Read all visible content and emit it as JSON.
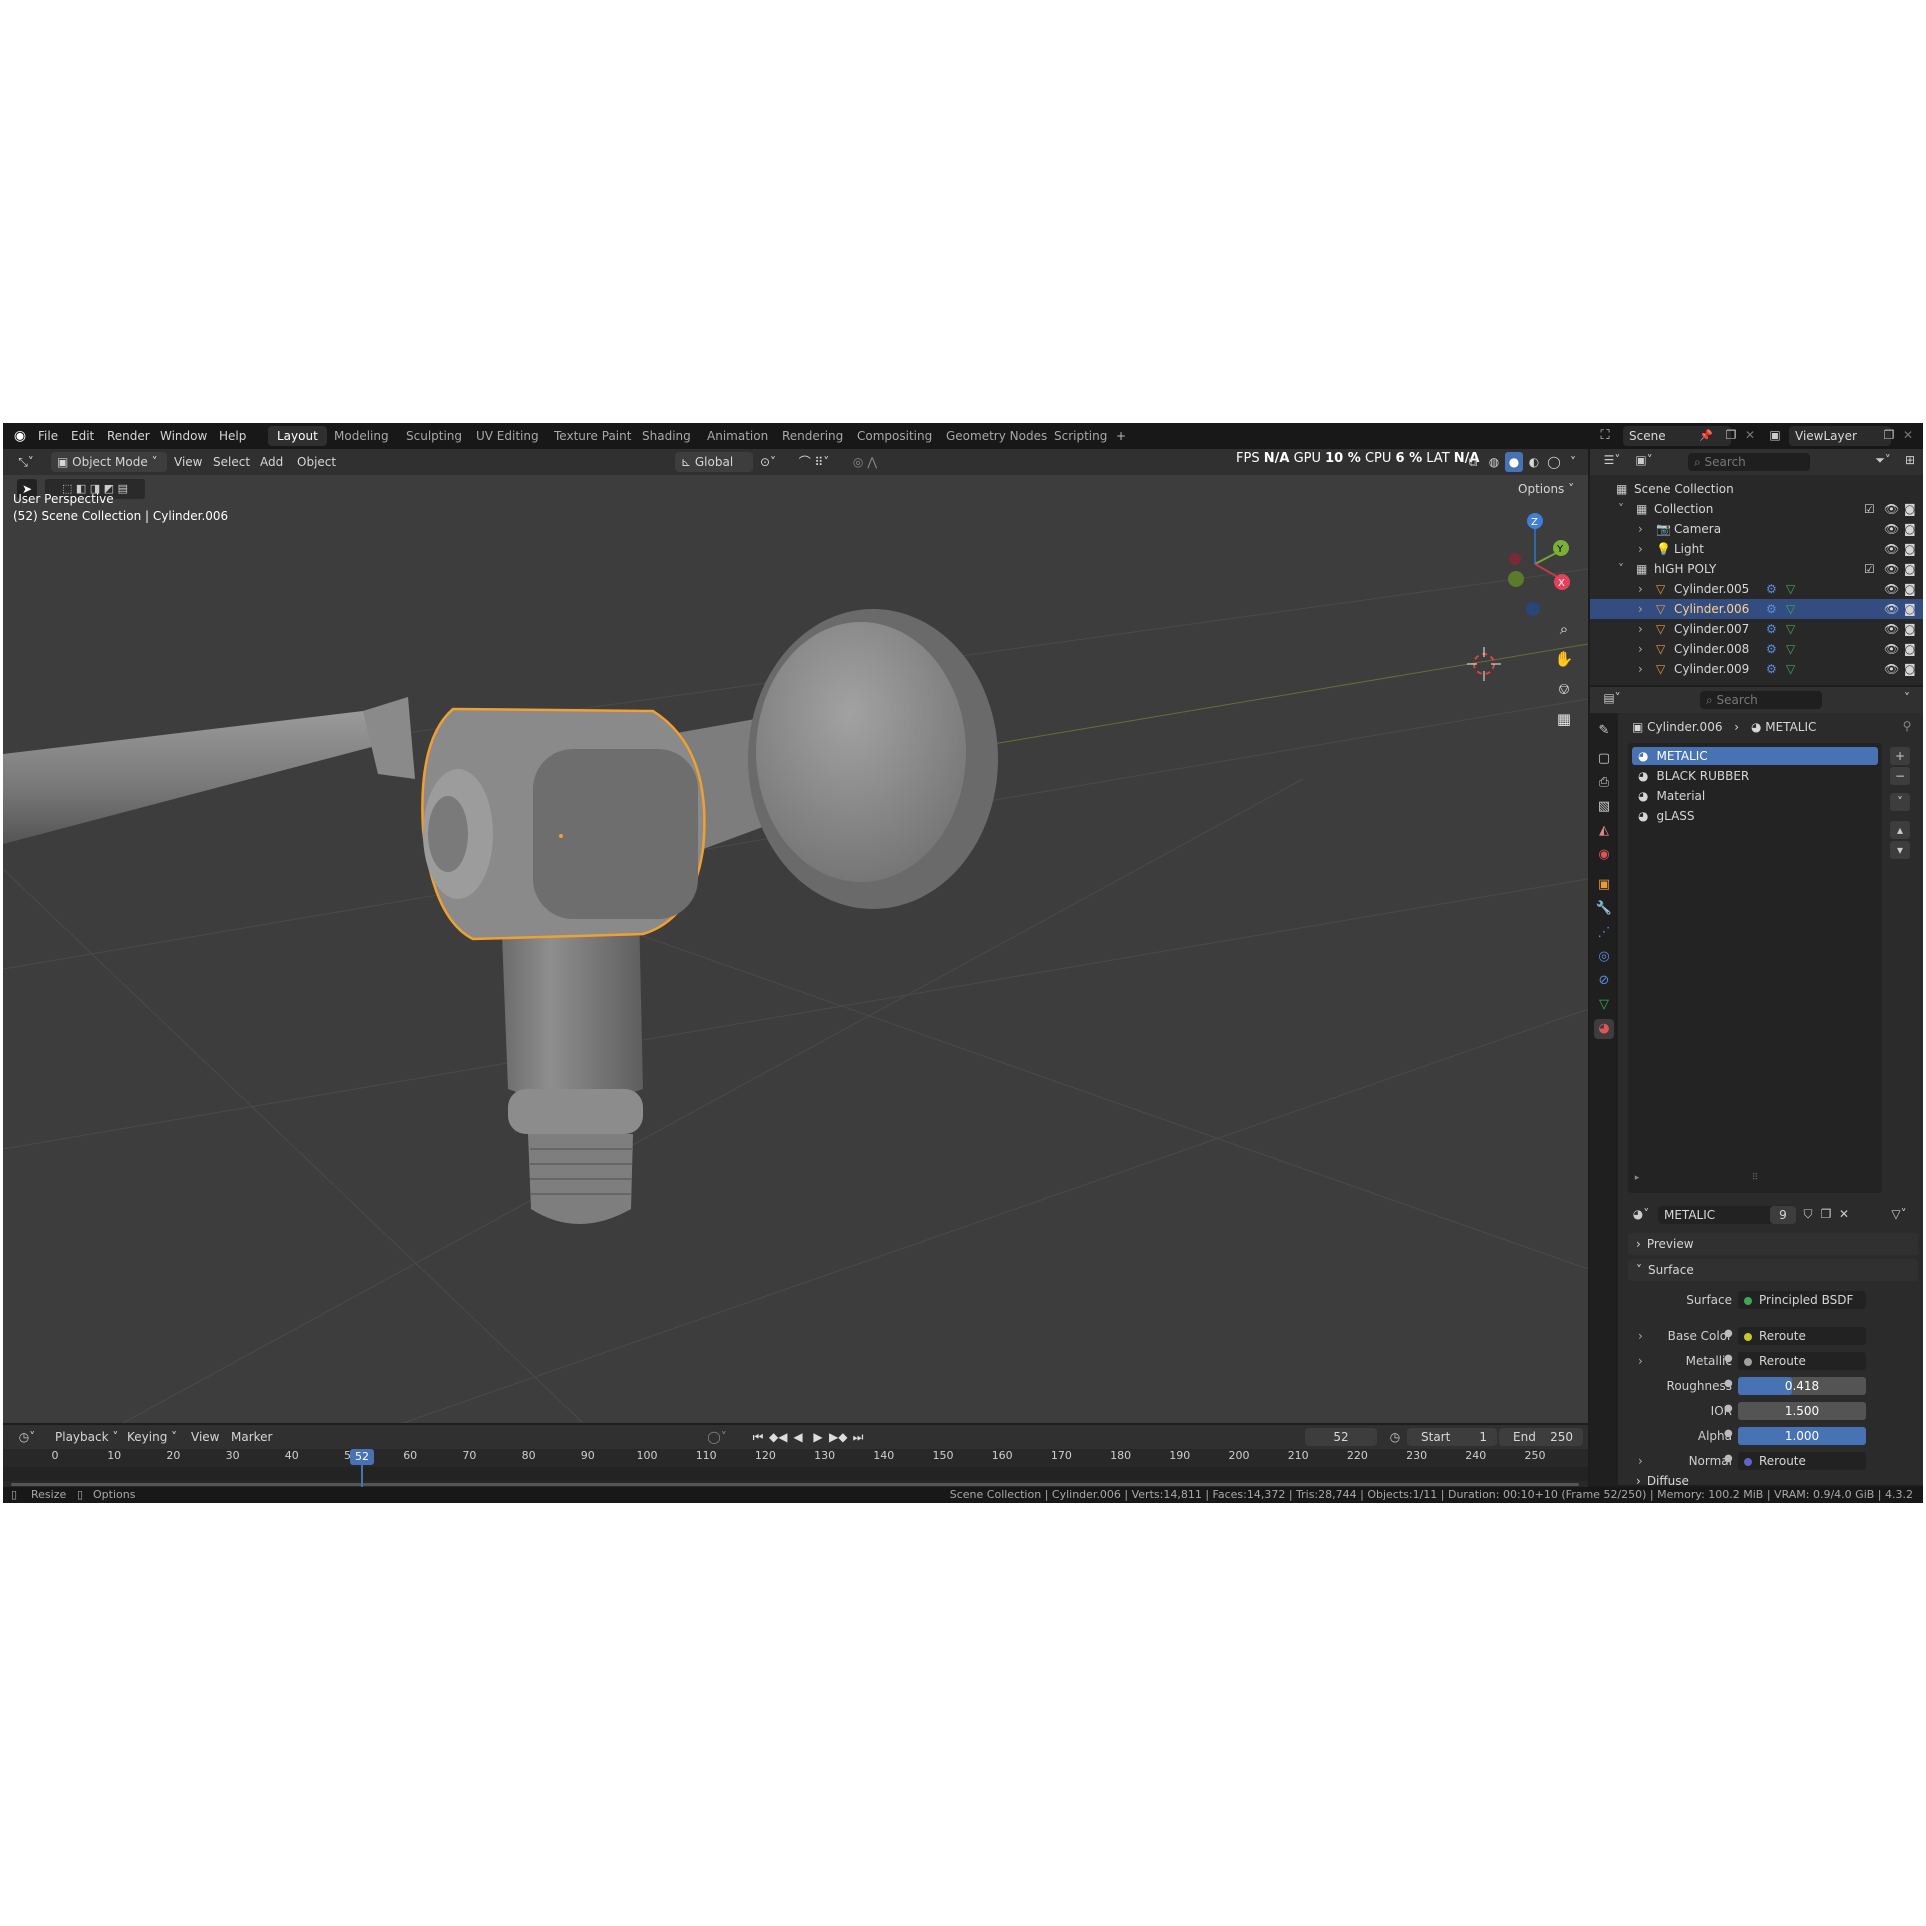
{
  "menu": [
    "File",
    "Edit",
    "Render",
    "Window",
    "Help"
  ],
  "workspaces": [
    {
      "label": "Layout",
      "active": true
    },
    {
      "label": "Modeling"
    },
    {
      "label": "Sculpting"
    },
    {
      "label": "UV Editing"
    },
    {
      "label": "Texture Paint"
    },
    {
      "label": "Shading"
    },
    {
      "label": "Animation"
    },
    {
      "label": "Rendering"
    },
    {
      "label": "Compositing"
    },
    {
      "label": "Geometry Nodes"
    },
    {
      "label": "Scripting"
    }
  ],
  "add_workspace": "+",
  "scene": {
    "name": "Scene",
    "view_layer": "ViewLayer"
  },
  "viewport": {
    "mode": "Object Mode",
    "menus": [
      "View",
      "Select",
      "Add",
      "Object"
    ],
    "orientation": "Global",
    "options": "Options",
    "perspective": "User Perspective",
    "collection_info": "(52) Scene Collection | Cylinder.006",
    "stats": {
      "fps_label": "FPS",
      "fps": "N/A",
      "gpu_label": "GPU",
      "gpu": "10 %",
      "cpu_label": "CPU",
      "cpu": "6 %",
      "lat_label": "LAT",
      "lat": "N/A"
    },
    "gizmo": {
      "x": "X",
      "y": "Y",
      "z": "Z"
    }
  },
  "outliner": {
    "search_placeholder": "Search",
    "rows": [
      {
        "label": "Scene Collection",
        "indent": 0
      },
      {
        "label": "Collection",
        "indent": 1
      },
      {
        "label": "Camera",
        "indent": 2
      },
      {
        "label": "Light",
        "indent": 2
      },
      {
        "label": "hIGH POLY",
        "indent": 1
      },
      {
        "label": "Cylinder.005",
        "indent": 2
      },
      {
        "label": "Cylinder.006",
        "indent": 2,
        "selected": true
      },
      {
        "label": "Cylinder.007",
        "indent": 2
      },
      {
        "label": "Cylinder.008",
        "indent": 2
      },
      {
        "label": "Cylinder.009",
        "indent": 2
      }
    ]
  },
  "properties": {
    "search_placeholder": "Search",
    "breadcrumb": {
      "object": "Cylinder.006",
      "material": "METALIC"
    },
    "slots": [
      {
        "label": "METALIC",
        "selected": true
      },
      {
        "label": "BLACK RUBBER"
      },
      {
        "label": "Material"
      },
      {
        "label": "gLASS"
      }
    ],
    "material_name": "METALIC",
    "users": "9",
    "panels": {
      "preview": "Preview",
      "surface": "Surface",
      "diffuse": "Diffuse"
    },
    "fields": [
      {
        "label": "Surface",
        "value": "Principled BSDF",
        "dot": "#3ea85a"
      },
      {
        "label": "Base Color",
        "value": "Reroute",
        "dot": "#c7c729",
        "expand": true
      },
      {
        "label": "Metallic",
        "value": "Reroute",
        "dot": "#a1a1a1",
        "expand": true
      },
      {
        "label": "Roughness",
        "value": "0.418",
        "slider": 0.418
      },
      {
        "label": "IOR",
        "value": "1.500",
        "slider": 0
      },
      {
        "label": "Alpha",
        "value": "1.000",
        "slider": 1.0
      },
      {
        "label": "Normal",
        "value": "Reroute",
        "dot": "#6363c7",
        "expand": true
      }
    ]
  },
  "timeline": {
    "menus": [
      "Playback",
      "Keying",
      "View",
      "Marker"
    ],
    "current_frame": "52",
    "start_label": "Start",
    "start": "1",
    "end_label": "End",
    "end": "250",
    "ticks": [
      "0",
      "10",
      "20",
      "30",
      "40",
      "50",
      "60",
      "70",
      "80",
      "90",
      "100",
      "110",
      "120",
      "130",
      "140",
      "150",
      "160",
      "170",
      "180",
      "190",
      "200",
      "210",
      "220",
      "230",
      "240",
      "250"
    ],
    "playhead_label": "52"
  },
  "status": {
    "left_1": "Resize",
    "left_2": "Options",
    "right": "Scene Collection | Cylinder.006 | Verts:14,811 | Faces:14,372 | Tris:28,744 | Objects:1/11 | Duration: 00:10+10 (Frame 52/250) | Memory: 100.2 MiB | VRAM: 0.9/4.0 GiB | 4.3.2"
  },
  "colors": {
    "selection": "#4772b3",
    "active_outline": "#f0a030",
    "outliner_selected": "#334d80"
  }
}
